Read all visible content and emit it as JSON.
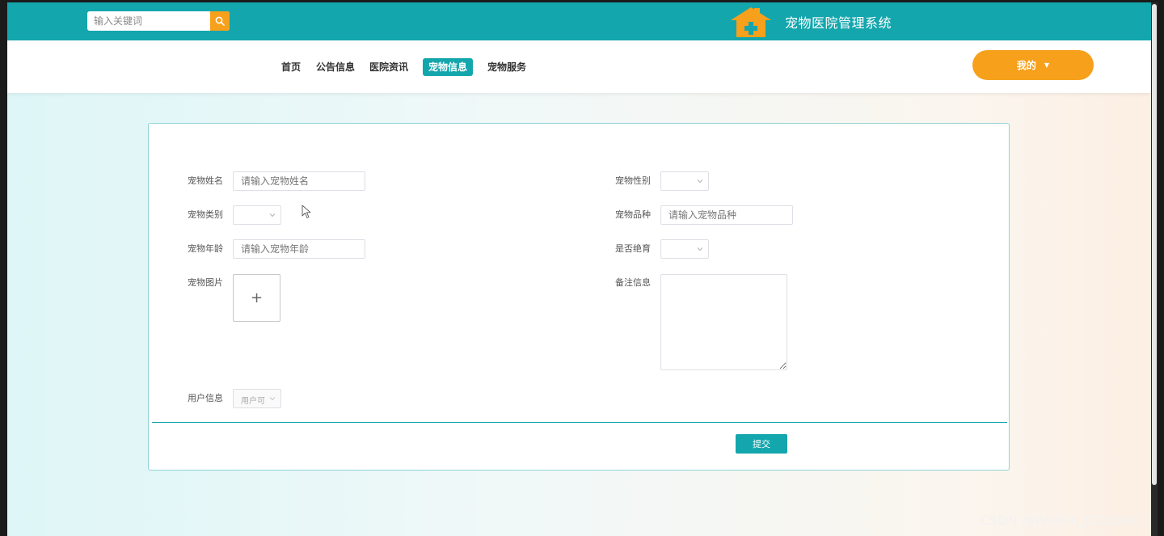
{
  "header": {
    "search_placeholder": "输入关键词",
    "site_title": "宠物医院管理系统",
    "search_icon": "search-icon",
    "logo_icon": "house-plus-icon"
  },
  "nav": {
    "items": [
      {
        "label": "首页",
        "active": false
      },
      {
        "label": "公告信息",
        "active": false
      },
      {
        "label": "医院资讯",
        "active": false
      },
      {
        "label": "宠物信息",
        "active": true
      },
      {
        "label": "宠物服务",
        "active": false
      }
    ],
    "user_menu_label": "我的",
    "user_menu_caret": "▼"
  },
  "form": {
    "pet_name": {
      "label": "宠物姓名",
      "placeholder": "请输入宠物姓名",
      "value": ""
    },
    "pet_gender": {
      "label": "宠物性别",
      "value": ""
    },
    "pet_type": {
      "label": "宠物类别",
      "value": ""
    },
    "pet_breed": {
      "label": "宠物品种",
      "placeholder": "请输入宠物品种",
      "value": ""
    },
    "pet_age": {
      "label": "宠物年龄",
      "placeholder": "请输入宠物年龄",
      "value": ""
    },
    "neutered": {
      "label": "是否绝育",
      "value": ""
    },
    "pet_image": {
      "label": "宠物图片",
      "upload_symbol": "+"
    },
    "notes": {
      "label": "备注信息",
      "value": ""
    },
    "user_info": {
      "label": "用户信息",
      "value": "用户可"
    },
    "submit_label": "提交"
  },
  "watermark": "CSDN @WeiXin_DZbishe",
  "colors": {
    "primary": "#14a6ad",
    "accent": "#f6a01b",
    "border": "#dcdfe6"
  }
}
